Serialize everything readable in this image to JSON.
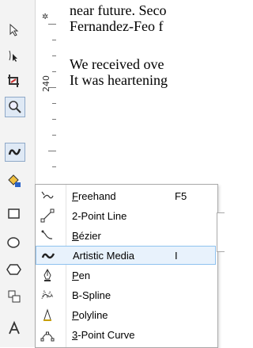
{
  "document": {
    "line1": "near future. Seco",
    "line2": "Fernandez-Feo f",
    "line3": "We received ove",
    "line4": "It was heartening"
  },
  "ruler": {
    "label": "240"
  },
  "toolbox": {
    "tools": [
      {
        "name": "pick-tool-icon"
      },
      {
        "name": "shape-tool-icon"
      },
      {
        "name": "crop-tool-icon"
      },
      {
        "name": "zoom-tool-icon"
      },
      {
        "name": "curve-tool-icon"
      },
      {
        "name": "smart-fill-tool-icon"
      },
      {
        "name": "rectangle-tool-icon"
      },
      {
        "name": "ellipse-tool-icon"
      },
      {
        "name": "polygon-tool-icon"
      },
      {
        "name": "object-tool-icon"
      },
      {
        "name": "text-tool-icon"
      }
    ]
  },
  "menu": {
    "items": [
      {
        "label": "Freehand",
        "shortcut": "F5",
        "icon": "freehand-icon"
      },
      {
        "label": "2-Point Line",
        "shortcut": "",
        "icon": "2-point-line-icon"
      },
      {
        "label": "Bézier",
        "shortcut": "",
        "icon": "bezier-icon"
      },
      {
        "label": "Artistic Media",
        "shortcut": "I",
        "icon": "artistic-media-icon"
      },
      {
        "label": "Pen",
        "shortcut": "",
        "icon": "pen-icon"
      },
      {
        "label": "B-Spline",
        "shortcut": "",
        "icon": "b-spline-icon"
      },
      {
        "label": "Polyline",
        "shortcut": "",
        "icon": "polyline-icon"
      },
      {
        "label": "3-Point Curve",
        "shortcut": "",
        "icon": "3-point-curve-icon"
      }
    ],
    "selected_index": 3
  },
  "colors": {
    "selection_bg": "#e8f2fc",
    "selection_border": "#8fc2ef"
  }
}
